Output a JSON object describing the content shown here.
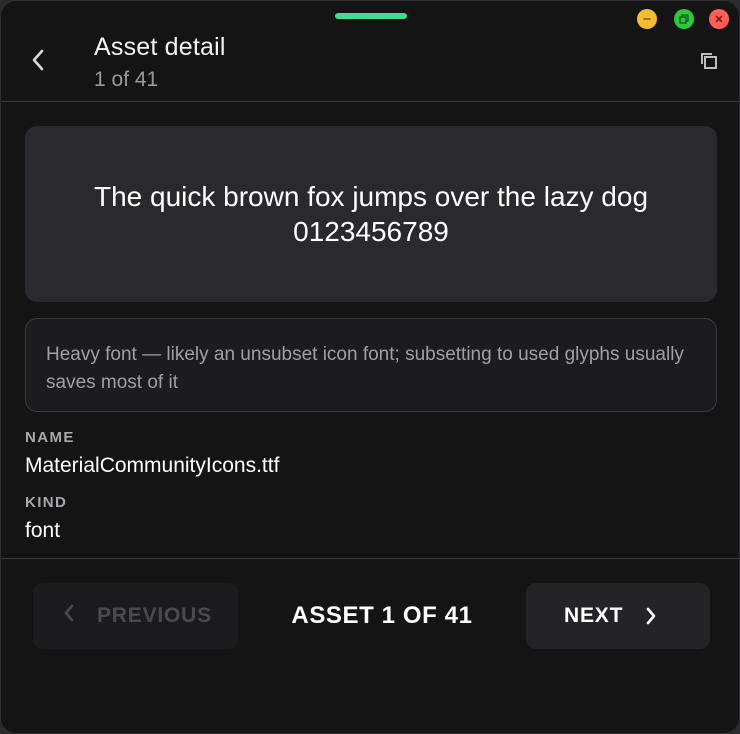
{
  "window": {
    "controls": {
      "minimize_icon": "minus-icon",
      "maximize_icon": "maximize-icon",
      "close_icon": "close-icon"
    },
    "colors": {
      "handle": "#3ddc97",
      "minimize": "#f4bd2f",
      "maximize": "#2bc840",
      "close": "#ff5f57"
    }
  },
  "header": {
    "title": "Asset detail",
    "subtitle": "1 of 41",
    "back_icon": "chevron-left-icon",
    "copy_icon": "copy-icon"
  },
  "preview": {
    "line1": "The quick brown fox jumps over the lazy dog",
    "line2": "0123456789"
  },
  "note": {
    "text": "Heavy font — likely an unsubset icon font; subsetting to used glyphs usually saves most of it"
  },
  "fields": [
    {
      "label": "NAME",
      "value": "MaterialCommunityIcons.ttf"
    },
    {
      "label": "KIND",
      "value": "font"
    }
  ],
  "footer": {
    "previous_label": "PREVIOUS",
    "previous_disabled": true,
    "counter": "ASSET 1 OF 41",
    "next_label": "NEXT"
  }
}
